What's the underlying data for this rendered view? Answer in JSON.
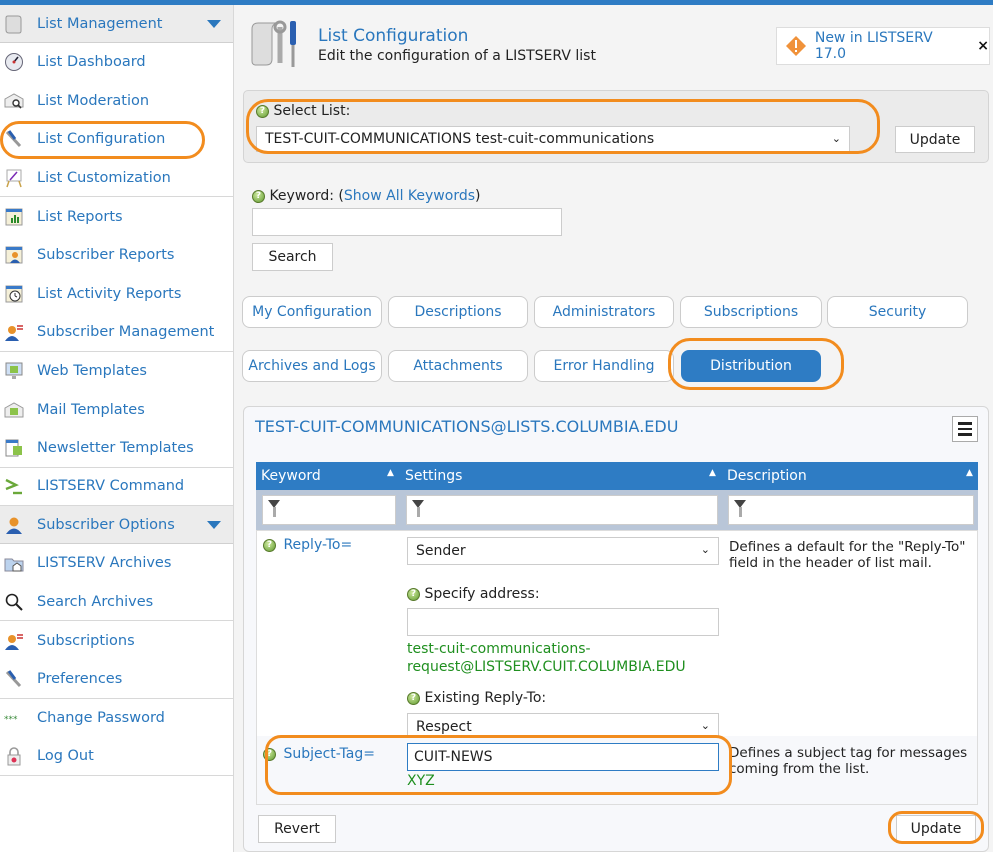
{
  "colors": {
    "accent": "#2e7cc4",
    "link": "#2a77bd",
    "highlight": "#f28c1e",
    "hint_green": "#1f8f1f"
  },
  "sidebar": {
    "sections": [
      {
        "header": {
          "label": "List Management",
          "icon": "scroll-icon"
        },
        "groups": [
          [
            {
              "label": "List Dashboard",
              "icon": "dashboard-gauge-icon"
            },
            {
              "label": "List Moderation",
              "icon": "envelope-magnifier-icon"
            },
            {
              "label": "List Configuration",
              "icon": "wrench-screwdriver-icon"
            },
            {
              "label": "List Customization",
              "icon": "easel-icon"
            }
          ],
          [
            {
              "label": "List Reports",
              "icon": "report-chart-icon"
            },
            {
              "label": "Subscriber Reports",
              "icon": "report-user-icon"
            },
            {
              "label": "List Activity Reports",
              "icon": "report-clock-icon"
            },
            {
              "label": "Subscriber Management",
              "icon": "user-manage-icon"
            }
          ],
          [
            {
              "label": "Web Templates",
              "icon": "monitor-puzzle-icon"
            },
            {
              "label": "Mail Templates",
              "icon": "mail-puzzle-icon"
            },
            {
              "label": "Newsletter Templates",
              "icon": "newsletter-puzzle-icon"
            }
          ],
          [
            {
              "label": "LISTSERV Command",
              "icon": "command-prompt-icon"
            }
          ]
        ]
      },
      {
        "header": {
          "label": "Subscriber Options",
          "icon": "user-icon"
        },
        "groups": [
          [
            {
              "label": "LISTSERV Archives",
              "icon": "archive-folder-icon"
            },
            {
              "label": "Search Archives",
              "icon": "magnifier-icon"
            }
          ],
          [
            {
              "label": "Subscriptions",
              "icon": "user-manage-icon"
            },
            {
              "label": "Preferences",
              "icon": "wrench-screwdriver-icon"
            }
          ],
          [
            {
              "label": "Change Password",
              "icon": "password-stars-icon"
            },
            {
              "label": "Log Out",
              "icon": "padlock-icon"
            }
          ]
        ]
      }
    ]
  },
  "header": {
    "title": "List Configuration",
    "subtitle": "Edit the configuration of a LISTSERV list",
    "news": {
      "label": "New in LISTSERV 17.0",
      "close": "×"
    }
  },
  "select_list": {
    "label": "Select List:",
    "value": "TEST-CUIT-COMMUNICATIONS test-cuit-communications",
    "update_label": "Update"
  },
  "keyword_search": {
    "label_prefix": "Keyword: (",
    "link": "Show All Keywords",
    "label_suffix": ")",
    "value": "",
    "search_label": "Search"
  },
  "tabs": [
    {
      "label": "My Configuration",
      "active": false
    },
    {
      "label": "Descriptions",
      "active": false
    },
    {
      "label": "Administrators",
      "active": false
    },
    {
      "label": "Subscriptions",
      "active": false
    },
    {
      "label": "Security",
      "active": false
    },
    {
      "label": "Archives and Logs",
      "active": false
    },
    {
      "label": "Attachments",
      "active": false
    },
    {
      "label": "Error Handling",
      "active": false
    },
    {
      "label": "Distribution",
      "active": true
    }
  ],
  "card": {
    "title": "TEST-CUIT-COMMUNICATIONS@LISTS.COLUMBIA.EDU",
    "columns": [
      "Keyword",
      "Settings",
      "Description"
    ],
    "rows": [
      {
        "keyword": "Reply-To=",
        "setting_value": "Sender",
        "description": "Defines a default for the \"Reply-To\" field in the header of list mail.",
        "specify_label": "Specify address:",
        "specify_value": "",
        "specify_hint": "test-cuit-communications-request@LISTSERV.CUIT.COLUMBIA.EDU",
        "existing_label": "Existing Reply-To:",
        "existing_value": "Respect"
      },
      {
        "keyword": "Subject-Tag=",
        "setting_value": "CUIT-NEWS",
        "hint": "XYZ",
        "description": "Defines a subject tag for messages coming from the list."
      }
    ],
    "revert_label": "Revert",
    "update_label": "Update"
  }
}
